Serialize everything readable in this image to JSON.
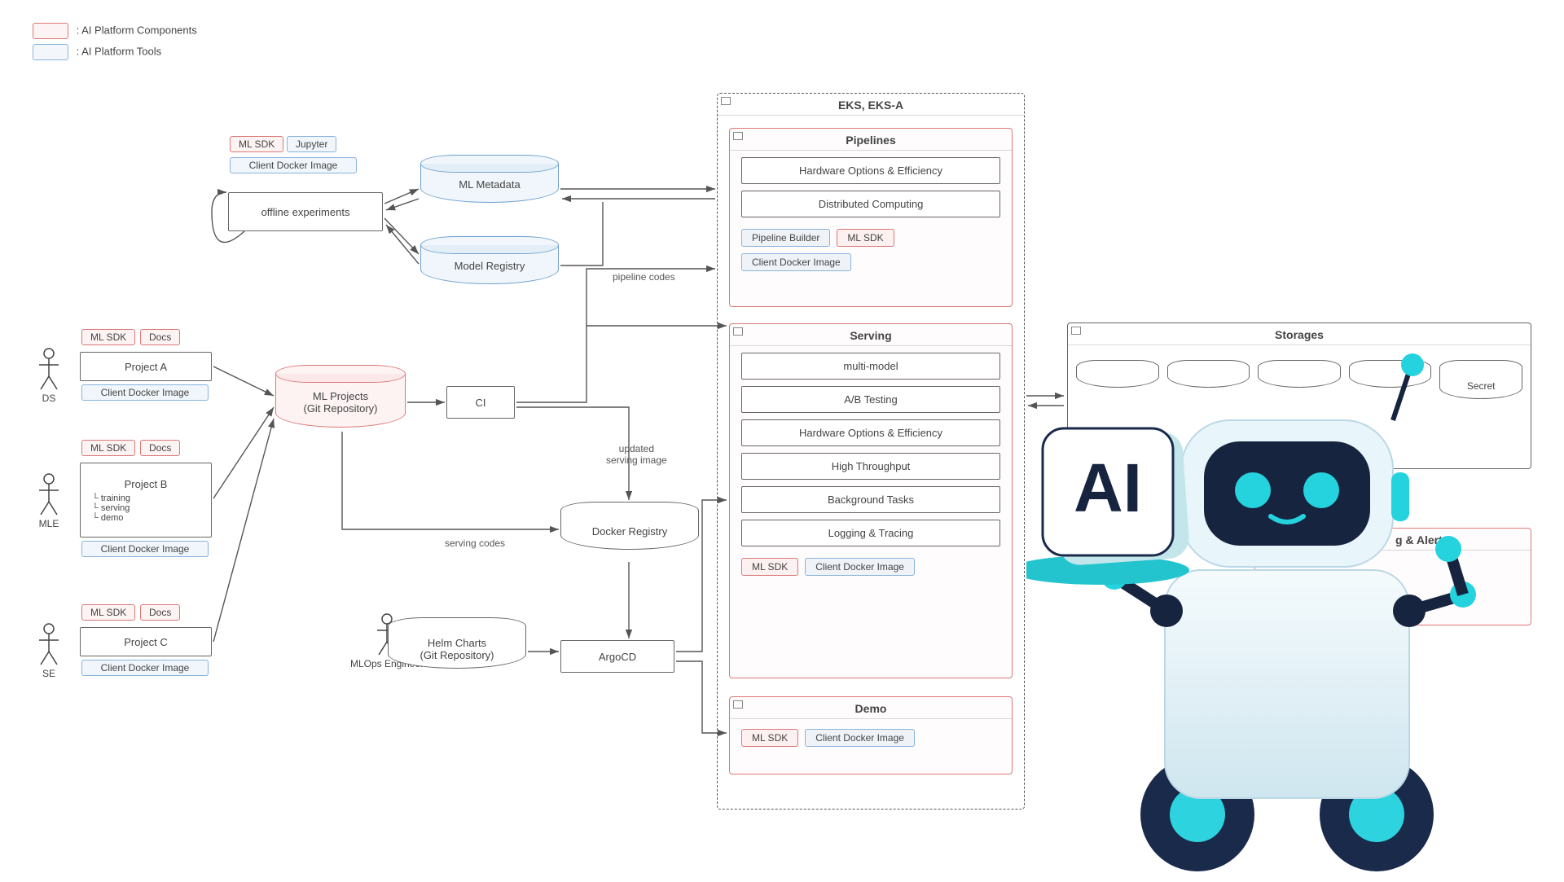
{
  "legend": {
    "components": ": AI Platform Components",
    "tools": ": AI Platform Tools"
  },
  "actors": {
    "ds": "DS",
    "mle": "MLE",
    "se": "SE",
    "mlops": "MLOps Engineer"
  },
  "projects": {
    "a": {
      "sdk": "ML SDK",
      "docs": "Docs",
      "name": "Project A",
      "docker": "Client Docker Image"
    },
    "b": {
      "sdk": "ML SDK",
      "docs": "Docs",
      "name": "Project B",
      "sub1": "training",
      "sub2": "serving",
      "sub3": "demo",
      "docker": "Client Docker Image"
    },
    "c": {
      "sdk": "ML SDK",
      "docs": "Docs",
      "name": "Project C",
      "docker": "Client Docker Image"
    }
  },
  "top": {
    "sdk": "ML SDK",
    "jupyter": "Jupyter",
    "docker": "Client Docker Image",
    "offline": "offline experiments",
    "metadata": "ML Metadata",
    "registry": "Model Registry"
  },
  "mid": {
    "mlprojects": "ML Projects\n(Git Repository)",
    "ci": "CI",
    "dockerreg": "Docker Registry",
    "helm": "Helm Charts\n(Git Repository)",
    "argocd": "ArgoCD"
  },
  "labels": {
    "pipeline_codes": "pipeline codes",
    "updated_serving": "updated\nserving image",
    "serving_codes": "serving codes"
  },
  "eks": {
    "title": "EKS, EKS-A",
    "pipelines": {
      "title": "Pipelines",
      "items": [
        "Hardware Options & Efficiency",
        "Distributed Computing"
      ],
      "tags": {
        "builder": "Pipeline Builder",
        "sdk": "ML SDK",
        "docker": "Client Docker Image"
      }
    },
    "serving": {
      "title": "Serving",
      "items": [
        "multi-model",
        "A/B Testing",
        "Hardware Options & Efficiency",
        "High Throughput",
        "Background Tasks",
        "Logging & Tracing"
      ],
      "tags": {
        "sdk": "ML SDK",
        "docker": "Client Docker Image"
      }
    },
    "demo": {
      "title": "Demo",
      "tags": {
        "sdk": "ML SDK",
        "docker": "Client Docker Image"
      }
    }
  },
  "storages": {
    "title": "Storages",
    "items": [
      "",
      "",
      "",
      "",
      "Secret"
    ]
  },
  "monitor": {
    "title": "Monitoring & Alert"
  },
  "colors": {
    "red": "#d77",
    "blue": "#88b3dd"
  }
}
